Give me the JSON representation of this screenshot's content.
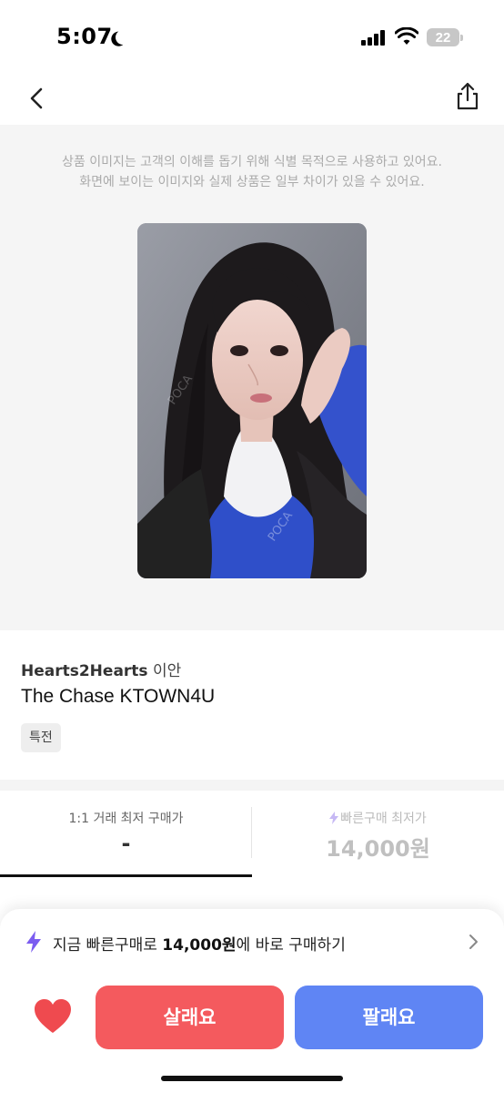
{
  "status_bar": {
    "time": "5:07",
    "battery": "22"
  },
  "image_section": {
    "notice_line1": "상품 이미지는 고객의 이해를 돕기 위해 식별 목적으로 사용하고 있어요.",
    "notice_line2": "화면에 보이는 이미지와 실제 상품은 일부 차이가 있을 수 있어요."
  },
  "product": {
    "artist": "Hearts2Hearts",
    "member": "이안",
    "title": "The Chase KTOWN4U",
    "tag": "특전"
  },
  "price_tabs": {
    "left_label": "1:1 거래 최저 구매가",
    "left_value": "-",
    "right_label": "빠른구매 최저가",
    "right_value": "14,000원"
  },
  "bottom_sheet": {
    "quick_buy_prefix": "지금 빠른구매로 ",
    "quick_buy_price": "14,000원",
    "quick_buy_suffix": "에 바로 구매하기",
    "buy_label": "살래요",
    "sell_label": "팔래요"
  },
  "colors": {
    "buy": "#f45a5e",
    "sell": "#5f85f4",
    "bolt": "#7b5cf0",
    "heart": "#ef4a4f"
  },
  "icons": [
    "back-arrow-icon",
    "share-icon",
    "bolt-icon",
    "chevron-right-icon",
    "heart-icon",
    "signal-icon",
    "wifi-icon",
    "battery-icon",
    "moon-icon"
  ]
}
